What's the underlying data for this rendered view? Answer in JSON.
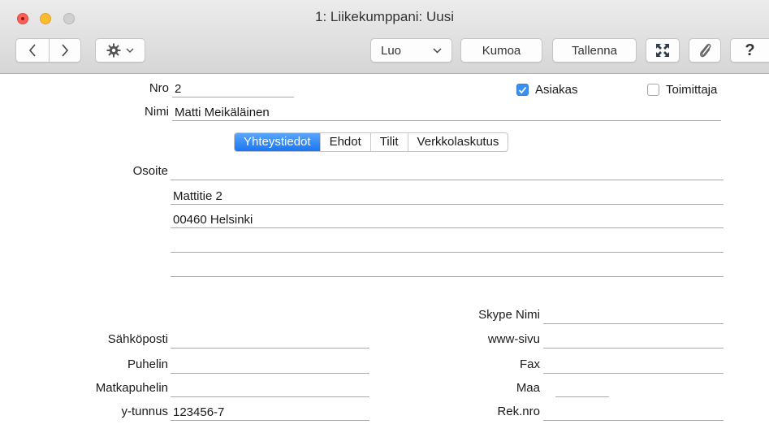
{
  "window": {
    "title": "1: Liikekumppani: Uusi"
  },
  "toolbar": {
    "back_glyph": "‹",
    "forward_glyph": "›",
    "luo_label": "Luo",
    "kumoa_label": "Kumoa",
    "tallenna_label": "Tallenna",
    "help_label": "?"
  },
  "form": {
    "nro_label": "Nro",
    "nro_value": "2",
    "nimi_label": "Nimi",
    "nimi_value": "Matti Meikäläinen",
    "asiakas_label": "Asiakas",
    "asiakas_checked": true,
    "toimittaja_label": "Toimittaja",
    "toimittaja_checked": false
  },
  "tabs": [
    {
      "label": "Yhteystiedot",
      "active": true
    },
    {
      "label": "Ehdot",
      "active": false
    },
    {
      "label": "Tilit",
      "active": false
    },
    {
      "label": "Verkkolaskutus",
      "active": false
    }
  ],
  "address": {
    "label": "Osoite",
    "lines": [
      "",
      "Mattitie 2",
      "00460 Helsinki",
      "",
      ""
    ]
  },
  "contact_left": {
    "email_label": "Sähköposti",
    "email_value": "",
    "phone_label": "Puhelin",
    "phone_value": "",
    "mobile_label": "Matkapuhelin",
    "mobile_value": "",
    "business_id_label": "y-tunnus",
    "business_id_value": "123456-7"
  },
  "contact_right": {
    "skype_label": "Skype Nimi",
    "skype_value": "",
    "www_label": "www-sivu",
    "www_value": "",
    "fax_label": "Fax",
    "fax_value": "",
    "country_label": "Maa",
    "country_value": "",
    "reg_label": "Rek.nro",
    "reg_value": ""
  },
  "colors": {
    "accent": "#1a76f2",
    "checkbox_on": "#3a8ff5",
    "close": "#fc5f57",
    "minimize": "#fdbc2e"
  }
}
